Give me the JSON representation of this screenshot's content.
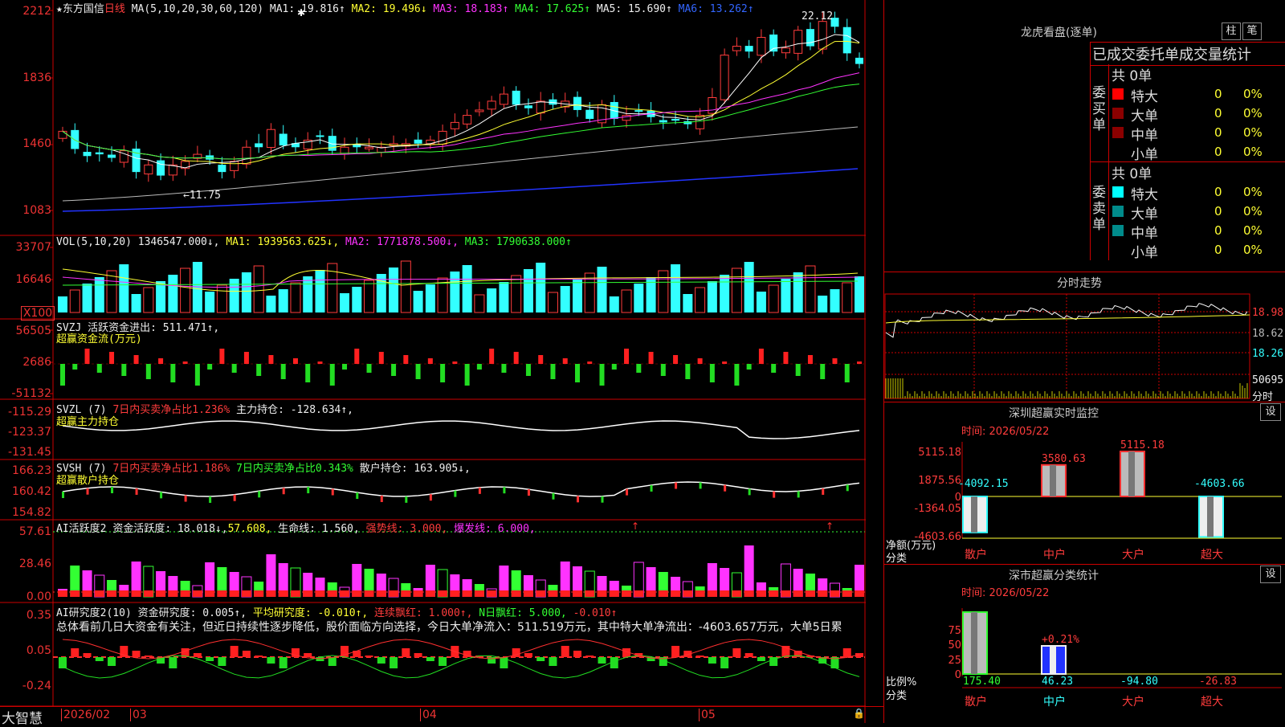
{
  "stock": {
    "name": "东方国信",
    "period": "日线",
    "star": "★"
  },
  "ma_line": {
    "label": "MA(5,10,20,30,60,120)",
    "ma1": "MA1: 19.816↑",
    "ma2": "MA2: 19.496↓",
    "ma3": "MA3: 18.183↑",
    "ma4": "MA4: 17.625↑",
    "ma5": "MA5: 15.690↑",
    "ma6": "MA6: 13.262↑"
  },
  "price_axis": [
    "2212",
    "1836",
    "1460",
    "1083"
  ],
  "price_annotations": {
    "high": "22.12",
    "low": "←11.75"
  },
  "vol_line": {
    "label": "VOL(5,10,20)",
    "value": "1346547.000↓,",
    "ma1": "MA1: 1939563.625↓,",
    "ma2": "MA2: 1771878.500↓,",
    "ma3": "MA3: 1790638.000↑"
  },
  "vol_axis": [
    "33707",
    "16646",
    "X100"
  ],
  "svzj": {
    "label": "SVZJ",
    "text": "活跃资金进出: 511.471↑,",
    "sub": "超赢资金流(万元)",
    "axis": [
      "56505",
      "2686",
      "-51132"
    ]
  },
  "svzl": {
    "label": "SVZL (7)",
    "red": "7日内买卖净占比1.236%",
    "text": "主力持仓: -128.634↑,",
    "sub": "超赢主力持仓",
    "axis": [
      "-115.29",
      "-123.37",
      "-131.45"
    ]
  },
  "svsh": {
    "label": "SVSH (7)",
    "red": "7日内买卖净占比1.186%",
    "grn": "7日内买卖净占比0.343%",
    "text": "散户持仓: 163.905↓,",
    "sub": "超赢散户持仓",
    "axis": [
      "166.23",
      "160.42",
      "154.82"
    ]
  },
  "ai1": {
    "label": "AI活跃度2",
    "text": "资金活跃度: 18.018↓,",
    "y": "57.608,",
    "life": "生命线: 1.560,",
    "strong": "强势线: 3.000,",
    "burst": "爆发线: 6.000,",
    "axis": [
      "57.61",
      "28.46",
      "0.00"
    ]
  },
  "ai2": {
    "label": "AI研究度2(10)",
    "text": "资金研究度: 0.005↑,",
    "avg": "平均研究度: -0.010↑,",
    "red": "连续飘红: 1.000↑,",
    "nred": "N日飘红: 5.000,",
    "last": "-0.010↑",
    "axis": [
      "0.35",
      "0.05",
      "-0.24"
    ]
  },
  "summary": "总体看前几日大资金有关注，但近日持续性逐步降低，股价面临方向选择，今日大单净流入：511.519万元，其中特大单净流出：-4603.657万元，大单5日累",
  "bottom": {
    "brand": "大智慧",
    "year": "2026/02",
    "m03": "03",
    "m04": "04",
    "m05": "05"
  },
  "lhb": {
    "title": "龙虎看盘(逐单)",
    "btn1": "柱",
    "btn2": "笔",
    "heading": "已成交委托单成交量统计",
    "buy_label": "委买单",
    "sell_label": "委卖单",
    "buy_total": "共 0单",
    "sell_total": "共 0单",
    "buy_rows": [
      {
        "name": "特大",
        "n": "0",
        "p": "0%"
      },
      {
        "name": "大单",
        "n": "0",
        "p": "0%"
      },
      {
        "name": "中单",
        "n": "0",
        "p": "0%"
      },
      {
        "name": "小单",
        "n": "0",
        "p": "0%"
      }
    ],
    "sell_rows": [
      {
        "name": "特大",
        "n": "0",
        "p": "0%"
      },
      {
        "name": "大单",
        "n": "0",
        "p": "0%"
      },
      {
        "name": "中单",
        "n": "0",
        "p": "0%"
      },
      {
        "name": "小单",
        "n": "0",
        "p": "0%"
      }
    ],
    "buy_colors": [
      "#ff0000",
      "#8b0000",
      "#8b0000",
      "#000000"
    ],
    "sell_colors": [
      "#00ffff",
      "#008b8b",
      "#008b8b",
      "#000000"
    ]
  },
  "fenshi": {
    "title": "分时走势",
    "axis": [
      "18.98",
      "18.62",
      "18.26"
    ],
    "vol": "50695",
    "vol_label": "分时"
  },
  "sz_monitor": {
    "title": "深圳超赢实时监控",
    "set": "设",
    "time": "时间: 2026/05/22",
    "axis": [
      "5115.18",
      "1875.56",
      "0",
      "-1364.05",
      "-4603.66"
    ],
    "values": [
      "-4092.15",
      "3580.63",
      "5115.18",
      "-4603.66"
    ],
    "ylabel": "净额(万元)",
    "xlabel": "分类",
    "cats": [
      "散户",
      "中户",
      "大户",
      "超大"
    ]
  },
  "sz_class": {
    "title": "深市超赢分类统计",
    "set": "设",
    "time": "时间: 2026/05/22",
    "axis": [
      "75",
      "50",
      "25",
      "0"
    ],
    "bar_label": "+0.21%",
    "values": [
      "175.40",
      "46.23",
      "-94.80",
      "-26.83"
    ],
    "ylabel": "比例%",
    "xlabel": "分类",
    "cats": [
      "散户",
      "中户",
      "大户",
      "超大"
    ]
  },
  "chart_data": {
    "type": "candlestick",
    "title": "东方国信 日线",
    "x_months": [
      "2026/02",
      "03",
      "04",
      "05"
    ],
    "ylim": [
      1083,
      2212
    ],
    "close": [
      1530,
      1430,
      1390,
      1400,
      1380,
      1420,
      1300,
      1340,
      1280,
      1340,
      1360,
      1400,
      1370,
      1300,
      1360,
      1440,
      1440,
      1540,
      1450,
      1440,
      1480,
      1500,
      1420,
      1440,
      1440,
      1440,
      1440,
      1460,
      1460,
      1460,
      1480,
      1530,
      1580,
      1620,
      1650,
      1700,
      1740,
      1680,
      1660,
      1700,
      1680,
      1700,
      1650,
      1600,
      1680,
      1600,
      1620,
      1640,
      1610,
      1580,
      1590,
      1570,
      1620,
      1720,
      1960,
      2010,
      1980,
      2060,
      1980,
      2000,
      2100,
      2010,
      2150,
      2120,
      1970,
      1910
    ]
  }
}
